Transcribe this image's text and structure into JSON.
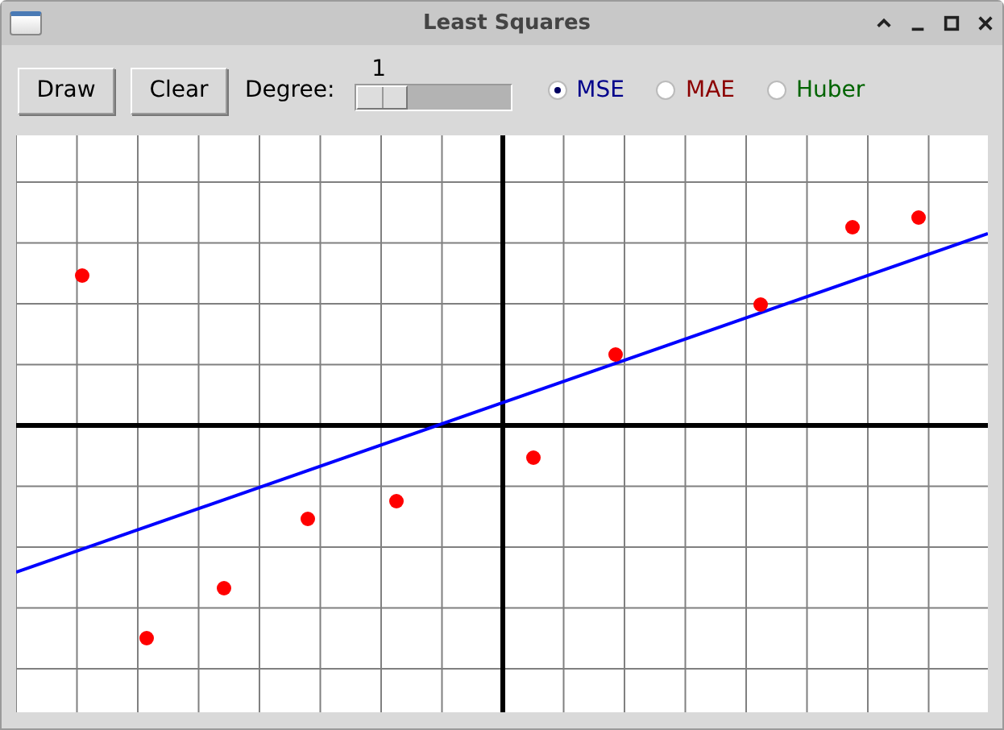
{
  "window": {
    "title": "Least Squares"
  },
  "toolbar": {
    "buttons": [
      {
        "label": "Draw"
      },
      {
        "label": "Clear"
      }
    ],
    "degree": {
      "label": "Degree:",
      "value": "1",
      "level": 0
    },
    "loss_options": [
      {
        "label": "MSE",
        "selected": true,
        "color": "#00008b"
      },
      {
        "label": "MAE",
        "selected": false,
        "color": "#8b0000"
      },
      {
        "label": "Huber",
        "selected": false,
        "color": "#006400"
      }
    ]
  }
}
